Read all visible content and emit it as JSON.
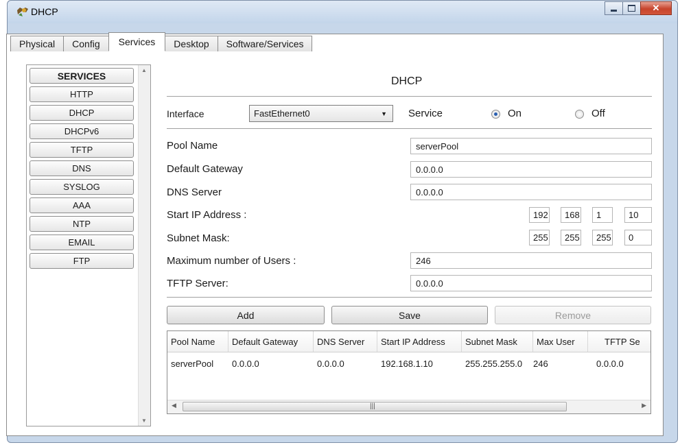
{
  "window": {
    "title": "DHCP"
  },
  "tabs": [
    {
      "label": "Physical"
    },
    {
      "label": "Config"
    },
    {
      "label": "Services"
    },
    {
      "label": "Desktop"
    },
    {
      "label": "Software/Services"
    }
  ],
  "active_tab": "Services",
  "services": {
    "header": "SERVICES",
    "items": [
      "HTTP",
      "DHCP",
      "DHCPv6",
      "TFTP",
      "DNS",
      "SYSLOG",
      "AAA",
      "NTP",
      "EMAIL",
      "FTP"
    ]
  },
  "dhcp": {
    "heading": "DHCP",
    "interface_label": "Interface",
    "interface_value": "FastEthernet0",
    "service_label": "Service",
    "on_label": "On",
    "off_label": "Off",
    "service_state": "On",
    "pool_name_label": "Pool Name",
    "pool_name_value": "serverPool",
    "gateway_label": "Default Gateway",
    "gateway_value": "0.0.0.0",
    "dns_label": "DNS Server",
    "dns_value": "0.0.0.0",
    "start_ip_label": "Start IP Address :",
    "start_ip": [
      "192",
      "168",
      "1",
      "10"
    ],
    "subnet_label": "Subnet Mask:",
    "subnet": [
      "255",
      "255",
      "255",
      "0"
    ],
    "max_users_label": "Maximum number of Users :",
    "max_users_value": "246",
    "tftp_label": "TFTP Server:",
    "tftp_value": "0.0.0.0"
  },
  "buttons": {
    "add": "Add",
    "save": "Save",
    "remove": "Remove"
  },
  "table": {
    "headers": [
      "Pool Name",
      "Default Gateway",
      "DNS Server",
      "Start IP Address",
      "Subnet Mask",
      "Max User",
      "TFTP Se"
    ],
    "rows": [
      [
        "serverPool",
        "0.0.0.0",
        "0.0.0.0",
        "192.168.1.10",
        "255.255.255.0",
        "246",
        "0.0.0.0"
      ]
    ]
  }
}
